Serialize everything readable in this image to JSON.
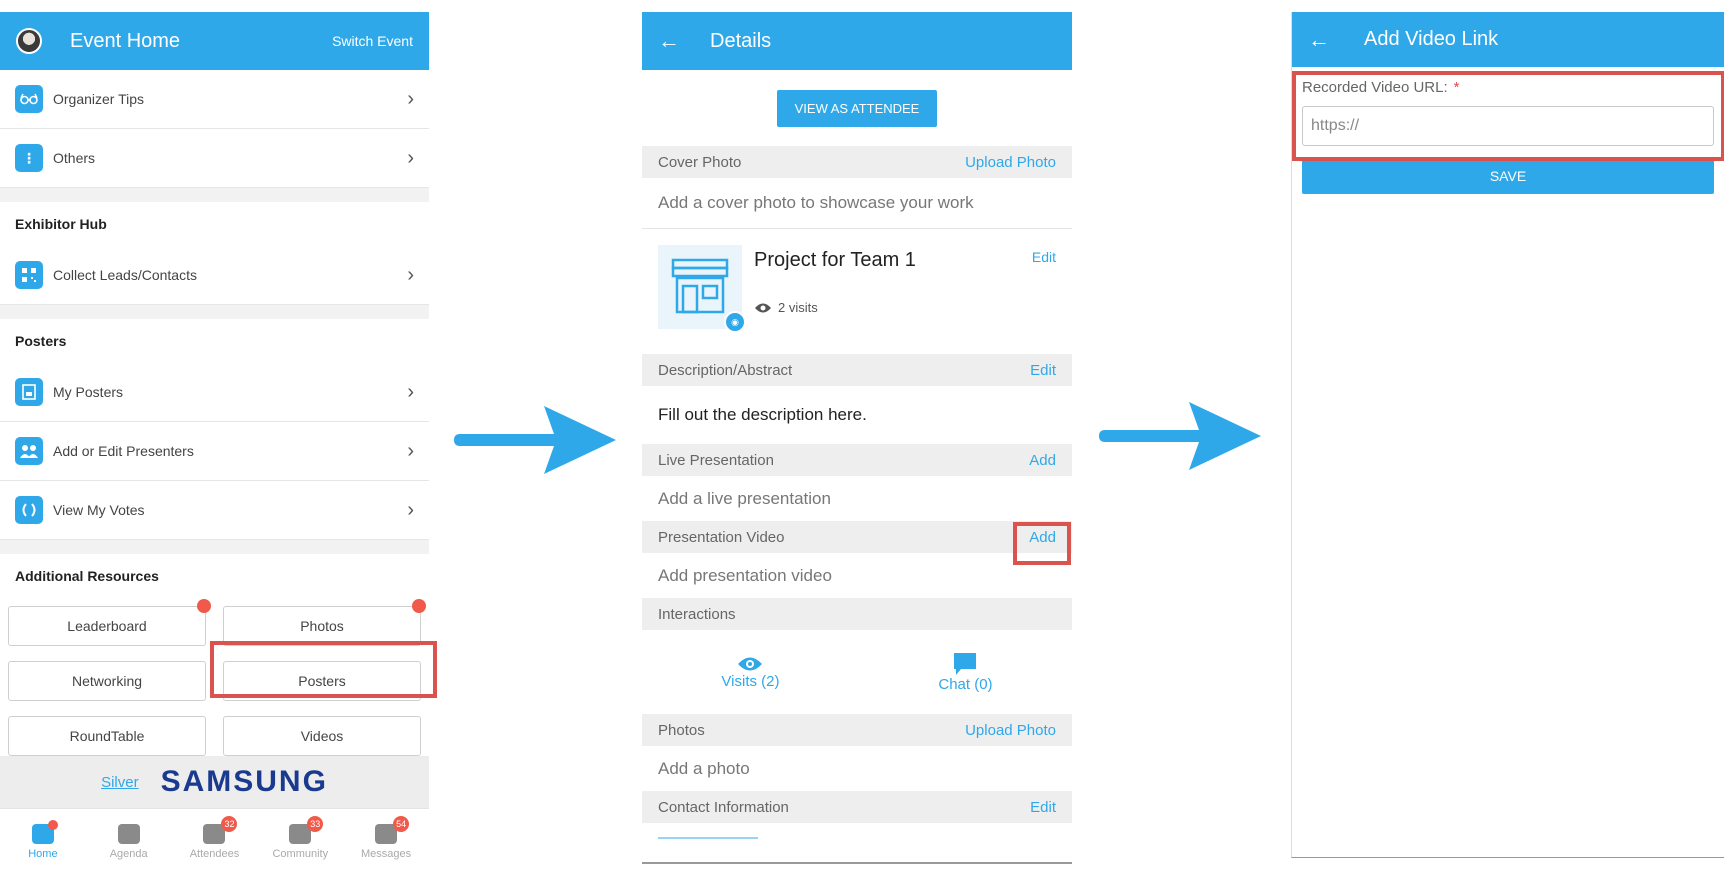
{
  "screen1": {
    "header": {
      "title": "Event Home",
      "switch_label": "Switch Event"
    },
    "menu_top": [
      {
        "label": "Organizer Tips",
        "icon": "glasses-icon"
      },
      {
        "label": "Others",
        "icon": "more-vertical-icon"
      }
    ],
    "exhibitor_hub": {
      "heading": "Exhibitor Hub",
      "items": [
        {
          "label": "Collect Leads/Contacts",
          "icon": "qr-code-icon"
        }
      ]
    },
    "posters": {
      "heading": "Posters",
      "items": [
        {
          "label": "My Posters",
          "icon": "poster-icon"
        },
        {
          "label": "Add or Edit Presenters",
          "icon": "presenters-icon"
        },
        {
          "label": "View My Votes",
          "icon": "laurel-icon"
        }
      ]
    },
    "additional_resources": {
      "heading": "Additional Resources",
      "buttons": [
        "Leaderboard",
        "Photos",
        "Networking",
        "Posters",
        "RoundTable",
        "Videos"
      ]
    },
    "sponsor": {
      "tier": "Silver",
      "brand": "SAMSUNG"
    },
    "tabs": [
      {
        "label": "Home",
        "badge": ""
      },
      {
        "label": "Agenda",
        "badge": ""
      },
      {
        "label": "Attendees",
        "badge": "32"
      },
      {
        "label": "Community",
        "badge": "33"
      },
      {
        "label": "Messages",
        "badge": "54"
      }
    ]
  },
  "screen2": {
    "header": {
      "title": "Details"
    },
    "view_as_attendee": "VIEW AS ATTENDEE",
    "cover_photo": {
      "heading": "Cover Photo",
      "action": "Upload Photo",
      "body": "Add a cover photo to showcase your work"
    },
    "project": {
      "title": "Project for Team 1",
      "visits": "2 visits",
      "edit": "Edit"
    },
    "description": {
      "heading": "Description/Abstract",
      "action": "Edit",
      "body": "Fill out the description here."
    },
    "live_presentation": {
      "heading": "Live Presentation",
      "action": "Add",
      "body": "Add a live presentation"
    },
    "presentation_video": {
      "heading": "Presentation Video",
      "action": "Add",
      "body": "Add presentation video"
    },
    "interactions": {
      "heading": "Interactions",
      "visits": "Visits (2)",
      "chat": "Chat (0)"
    },
    "photos": {
      "heading": "Photos",
      "action": "Upload Photo",
      "body": "Add a photo"
    },
    "contact": {
      "heading": "Contact Information",
      "action": "Edit"
    }
  },
  "screen3": {
    "header": {
      "title": "Add Video Link"
    },
    "field_label": "Recorded Video URL:",
    "required_mark": "*",
    "input_placeholder": "https://",
    "save_label": "SAVE"
  },
  "colors": {
    "primary": "#2fa8ea",
    "highlight": "#d9534f",
    "badge": "#f15a4a"
  }
}
